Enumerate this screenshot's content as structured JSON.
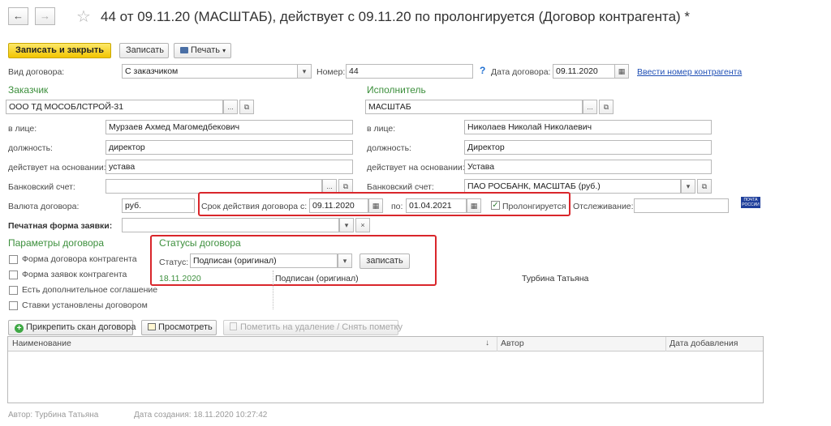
{
  "window": {
    "title": "44 от 09.11.20 (МАСШТАБ), действует с 09.11.20 по  пролонгируется (Договор контрагента) *",
    "back_icon": "←",
    "forward_icon": "→",
    "star_icon": "☆"
  },
  "toolbar": {
    "save_close_label": "Записать и закрыть",
    "save_label": "Записать",
    "print_label": "Печать"
  },
  "header": {
    "contract_type_label": "Вид договора:",
    "contract_type_value": "С заказчиком",
    "number_label": "Номер:",
    "number_value": "44",
    "help_icon": "?",
    "contract_date_label": "Дата договора:",
    "contract_date_value": "09.11.2020",
    "enter_counterparty_number_link": "Ввести номер контрагента"
  },
  "customer": {
    "heading": "Заказчик",
    "name": "ООО ТД МОСОБЛСТРОЙ-31",
    "represented_by_label": "в лице:",
    "represented_by_value": "Мурзаев Ахмед Магомедбекович",
    "position_label": "должность:",
    "position_value": "директор",
    "basis_label": "действует на основании:",
    "basis_value": "устава",
    "bank_account_label": "Банковский счет:",
    "bank_account_value": ""
  },
  "contractor": {
    "heading": "Исполнитель",
    "name": "МАСШТАБ",
    "represented_by_label": "в лице:",
    "represented_by_value": "Николаев Николай Николаевич",
    "position_label": "должность:",
    "position_value": "Директор",
    "basis_label": "действует на основании:",
    "basis_value": "Устава",
    "bank_account_label": "Банковский счет:",
    "bank_account_value": "ПАО РОСБАНК, МАСШТАБ (руб.)"
  },
  "terms": {
    "currency_label": "Валюта договора:",
    "currency_value": "руб.",
    "validity_from_label": "Срок действия договора с:",
    "validity_from_value": "09.11.2020",
    "validity_to_label": "по:",
    "validity_to_value": "01.04.2021",
    "prolongation_label": "Пролонгируется",
    "prolongation_checked": true,
    "tracking_label": "Отслеживание:",
    "tracking_value": "",
    "post_badge_line1": "ПОЧТА",
    "post_badge_line2": "РОССИИ"
  },
  "print_form": {
    "label": "Печатная форма заявки:",
    "value": ""
  },
  "params": {
    "heading": "Параметры договора",
    "options": [
      {
        "label": "Форма договора контрагента",
        "checked": false
      },
      {
        "label": "Форма заявок контрагента",
        "checked": false
      },
      {
        "label": "Есть дополнительное соглашение",
        "checked": false
      },
      {
        "label": "Ставки установлены договором",
        "checked": false
      }
    ]
  },
  "statuses": {
    "heading": "Статусы договора",
    "status_label": "Статус:",
    "status_value": "Подписан (оригинал)",
    "save_button": "записать",
    "history": [
      {
        "date": "18.11.2020",
        "status": "Подписан (оригинал)",
        "user": "Турбина Татьяна"
      }
    ]
  },
  "scan_toolbar": {
    "attach_label": "Прикрепить скан договора",
    "view_label": "Просмотреть",
    "mark_delete_label": "Пометить на удаление / Снять пометку"
  },
  "files_table": {
    "columns": [
      "Наименование",
      "Автор",
      "Дата добавления"
    ],
    "sort_icon": "↓",
    "rows": []
  },
  "footer": {
    "author": "Автор: Турбина Татьяна",
    "created": "Дата создания: 18.11.2020 10:27:42"
  },
  "colors": {
    "accent_yellow": "#f5cd0f",
    "group_green": "#3c8f3c",
    "highlight_red": "#d9262b",
    "link_blue": "#1f4fb5"
  }
}
